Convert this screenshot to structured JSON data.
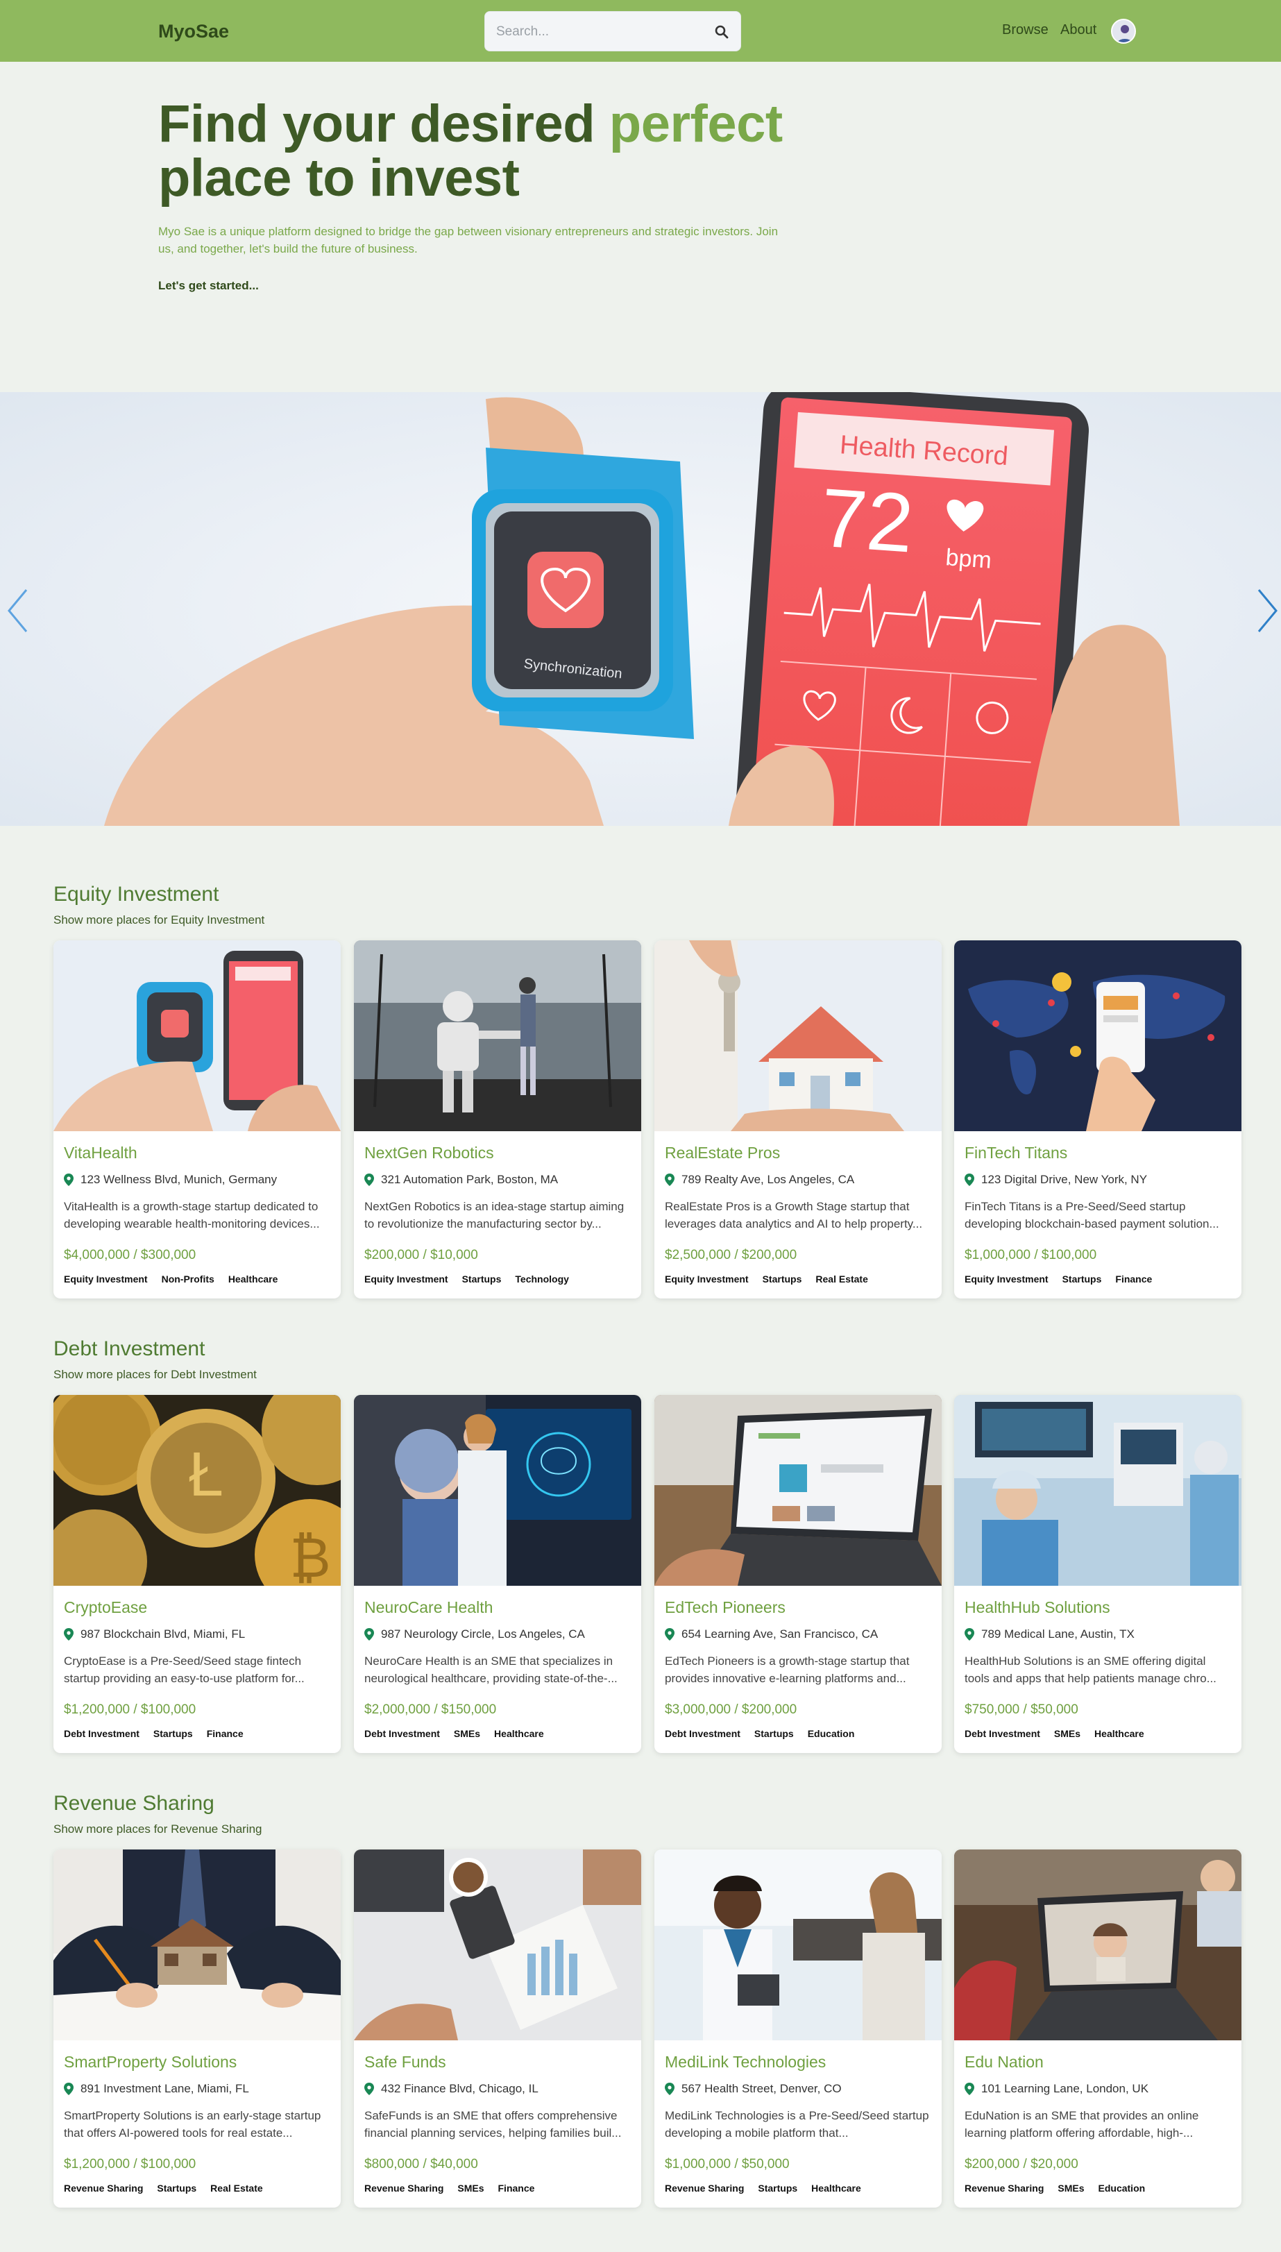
{
  "nav": {
    "brand": "MyoSae",
    "search_placeholder": "Search...",
    "browse": "Browse",
    "about": "About"
  },
  "hero": {
    "title_part1": "Find your desired ",
    "title_accent": "perfect",
    "title_part2": "place to invest",
    "subtitle": "Myo Sae is a unique platform designed to bridge the gap between visionary entrepreneurs and strategic investors. Join us, and together, let's build the future of business.",
    "cta": "Let's get started..."
  },
  "colors": {
    "nav_bg": "#8fb95e",
    "accent": "#7aa84a",
    "dark_green": "#3e5a26",
    "page_bg": "#eef2ed"
  },
  "sections": [
    {
      "title": "Equity Investment",
      "subtitle": "Show more places for Equity Investment",
      "cards": [
        {
          "name": "VitaHealth",
          "address": "123 Wellness Blvd, Munich, Germany",
          "description": "VitaHealth is a growth-stage startup dedicated to developing wearable health-monitoring devices...",
          "price": "$4,000,000 / $300,000",
          "tags": [
            "Equity Investment",
            "Non-Profits",
            "Healthcare"
          ]
        },
        {
          "name": "NextGen Robotics",
          "address": "321 Automation Park, Boston, MA",
          "description": "NextGen Robotics is an idea-stage startup aiming to revolutionize the manufacturing sector by...",
          "price": "$200,000 / $10,000",
          "tags": [
            "Equity Investment",
            "Startups",
            "Technology"
          ]
        },
        {
          "name": "RealEstate Pros",
          "address": "789 Realty Ave, Los Angeles, CA",
          "description": "RealEstate Pros is a Growth Stage startup that leverages data analytics and AI to help property...",
          "price": "$2,500,000 / $200,000",
          "tags": [
            "Equity Investment",
            "Startups",
            "Real Estate"
          ]
        },
        {
          "name": "FinTech Titans",
          "address": "123 Digital Drive, New York, NY",
          "description": "FinTech Titans is a Pre-Seed/Seed startup developing blockchain-based payment solution...",
          "price": "$1,000,000 / $100,000",
          "tags": [
            "Equity Investment",
            "Startups",
            "Finance"
          ]
        }
      ]
    },
    {
      "title": "Debt Investment",
      "subtitle": "Show more places for Debt Investment",
      "cards": [
        {
          "name": "CryptoEase",
          "address": "987 Blockchain Blvd, Miami, FL",
          "description": "CryptoEase is a Pre-Seed/Seed stage fintech startup providing an easy-to-use platform for...",
          "price": "$1,200,000 / $100,000",
          "tags": [
            "Debt Investment",
            "Startups",
            "Finance"
          ]
        },
        {
          "name": "NeuroCare Health",
          "address": "987 Neurology Circle, Los Angeles, CA",
          "description": "NeuroCare Health is an SME that specializes in neurological healthcare, providing state-of-the-...",
          "price": "$2,000,000 / $150,000",
          "tags": [
            "Debt Investment",
            "SMEs",
            "Healthcare"
          ]
        },
        {
          "name": "EdTech Pioneers",
          "address": "654 Learning Ave, San Francisco, CA",
          "description": "EdTech Pioneers is a growth-stage startup that provides innovative e-learning platforms and...",
          "price": "$3,000,000 / $200,000",
          "tags": [
            "Debt Investment",
            "Startups",
            "Education"
          ]
        },
        {
          "name": "HealthHub Solutions",
          "address": "789 Medical Lane, Austin, TX",
          "description": "HealthHub Solutions is an SME offering digital tools and apps that help patients manage chro...",
          "price": "$750,000 / $50,000",
          "tags": [
            "Debt Investment",
            "SMEs",
            "Healthcare"
          ]
        }
      ]
    },
    {
      "title": "Revenue Sharing",
      "subtitle": "Show more places for Revenue Sharing",
      "cards": [
        {
          "name": "SmartProperty Solutions",
          "address": "891 Investment Lane, Miami, FL",
          "description": "SmartProperty Solutions is an early-stage startup that offers AI-powered tools for real estate...",
          "price": "$1,200,000 / $100,000",
          "tags": [
            "Revenue Sharing",
            "Startups",
            "Real Estate"
          ]
        },
        {
          "name": "Safe Funds",
          "address": "432 Finance Blvd, Chicago, IL",
          "description": "SafeFunds is an SME that offers comprehensive financial planning services, helping families buil...",
          "price": "$800,000 / $40,000",
          "tags": [
            "Revenue Sharing",
            "SMEs",
            "Finance"
          ]
        },
        {
          "name": "MediLink Technologies",
          "address": "567 Health Street, Denver, CO",
          "description": "MediLink Technologies is a Pre-Seed/Seed startup developing a mobile platform that...",
          "price": "$1,000,000 / $50,000",
          "tags": [
            "Revenue Sharing",
            "Startups",
            "Healthcare"
          ]
        },
        {
          "name": "Edu Nation",
          "address": "101 Learning Lane, London, UK",
          "description": "EduNation is an SME that provides an online learning platform offering affordable, high-...",
          "price": "$200,000 / $20,000",
          "tags": [
            "Revenue Sharing",
            "SMEs",
            "Education"
          ]
        }
      ]
    }
  ],
  "carousel_slide_text": {
    "phone_header": "Health Record",
    "bpm_value": "72",
    "bpm_unit": "bpm",
    "watch_label": "Synchronization"
  }
}
